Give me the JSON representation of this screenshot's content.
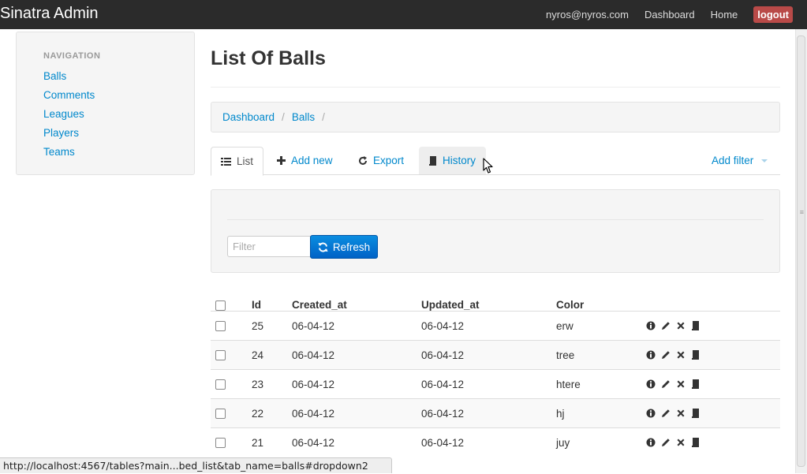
{
  "navbar": {
    "brand": "Sinatra Admin",
    "user_email": "nyros@nyros.com",
    "dashboard": "Dashboard",
    "home": "Home",
    "logout": "logout"
  },
  "sidebar": {
    "header": "NAVIGATION",
    "items": [
      {
        "label": "Balls"
      },
      {
        "label": "Comments"
      },
      {
        "label": "Leagues"
      },
      {
        "label": "Players"
      },
      {
        "label": "Teams"
      }
    ]
  },
  "page": {
    "title": "List Of Balls"
  },
  "breadcrumb": [
    "Dashboard",
    "Balls"
  ],
  "breadcrumb_sep": "/",
  "tabs": {
    "list": "List",
    "add_new": "Add new",
    "export": "Export",
    "history": "History",
    "add_filter": "Add filter"
  },
  "filter": {
    "placeholder": "Filter",
    "refresh": "Refresh"
  },
  "table": {
    "columns": [
      "Id",
      "Created_at",
      "Updated_at",
      "Color"
    ],
    "rows": [
      {
        "id": "25",
        "created_at": "06-04-12",
        "updated_at": "06-04-12",
        "color": "erw"
      },
      {
        "id": "24",
        "created_at": "06-04-12",
        "updated_at": "06-04-12",
        "color": "tree"
      },
      {
        "id": "23",
        "created_at": "06-04-12",
        "updated_at": "06-04-12",
        "color": "htere"
      },
      {
        "id": "22",
        "created_at": "06-04-12",
        "updated_at": "06-04-12",
        "color": "hj"
      },
      {
        "id": "21",
        "created_at": "06-04-12",
        "updated_at": "06-04-12",
        "color": "juy"
      }
    ],
    "row_actions": [
      "info-icon",
      "pencil-icon",
      "delete-icon",
      "history-icon"
    ]
  },
  "statusbar": {
    "url": "http://localhost:4567/tables?main...bed_list&tab_name=balls#dropdown2"
  },
  "colors": {
    "navbar_bg": "#2b2b2b",
    "link": "#0088cc",
    "logout_bg": "#b94a48",
    "primary_button": "#0062c6"
  }
}
